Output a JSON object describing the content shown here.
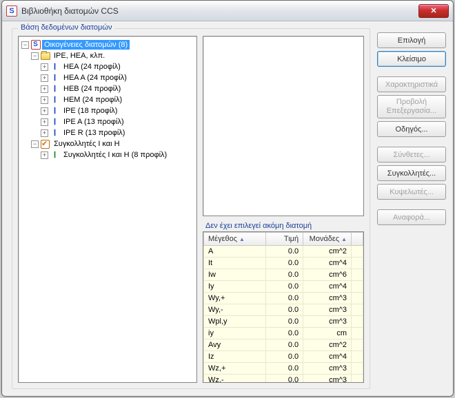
{
  "window": {
    "title": "Βιβλιοθήκη διατομών CCS"
  },
  "groupbox": {
    "title": "Βάση δεδομένων διατομών"
  },
  "tree": {
    "root_label": "Οικογένειες διατομών (8)",
    "node_ipe_group": "IPE, HEA, κλπ.",
    "leaves_ipe": [
      "HEA (24 προφίλ)",
      "HEA A (24 προφίλ)",
      "HEB (24 προφίλ)",
      "HEM (24 προφίλ)",
      "IPE (18 προφίλ)",
      "IPE A (13 προφίλ)",
      "IPE R (13 προφίλ)"
    ],
    "node_welded": "Συγκολλητές I και H",
    "leaf_welded": "Συγκολλητές I και H (8 προφίλ)"
  },
  "buttons": {
    "select": "Επιλογή",
    "close": "Κλείσιμο",
    "props": "Χαρακτηριστικά",
    "preview_edit": "Προβολή Επεξεργασία...",
    "wizard": "Οδηγός...",
    "composite": "Σύνθετες...",
    "welded": "Συγκολλητές...",
    "cellular": "Κυψελωτές...",
    "report": "Αναφορά..."
  },
  "props_panel": {
    "no_selection": "Δεν έχει επιλεγεί ακόμη διατομή",
    "headers": {
      "name": "Μέγεθος",
      "value": "Τιμή",
      "units": "Μονάδες"
    },
    "rows": [
      {
        "name": "A",
        "value": "0.0",
        "units": "cm^2"
      },
      {
        "name": "It",
        "value": "0.0",
        "units": "cm^4"
      },
      {
        "name": "Iw",
        "value": "0.0",
        "units": "cm^6"
      },
      {
        "name": "Iy",
        "value": "0.0",
        "units": "cm^4"
      },
      {
        "name": "Wy,+",
        "value": "0.0",
        "units": "cm^3"
      },
      {
        "name": "Wy,-",
        "value": "0.0",
        "units": "cm^3"
      },
      {
        "name": "Wpl,y",
        "value": "0.0",
        "units": "cm^3"
      },
      {
        "name": "iy",
        "value": "0.0",
        "units": "cm"
      },
      {
        "name": "Avy",
        "value": "0.0",
        "units": "cm^2"
      },
      {
        "name": "Iz",
        "value": "0.0",
        "units": "cm^4"
      },
      {
        "name": "Wz,+",
        "value": "0.0",
        "units": "cm^3"
      },
      {
        "name": "Wz,-",
        "value": "0.0",
        "units": "cm^3"
      }
    ]
  }
}
